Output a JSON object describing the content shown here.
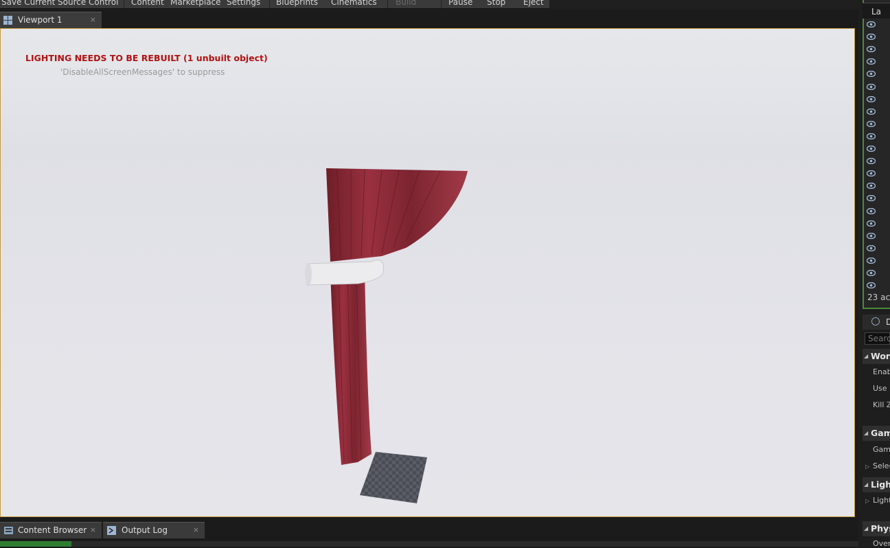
{
  "toolbar": {
    "items": [
      "Save Current",
      "Source Control",
      "Content",
      "Marketplace",
      "Settings",
      "Blueprints",
      "Cinematics",
      "Build",
      "Pause",
      "Stop",
      "Eject"
    ]
  },
  "viewport_tab": {
    "label": "Viewport 1",
    "close": "×"
  },
  "viewport": {
    "warning": "LIGHTING NEEDS TO BE REBUILT (1 unbuilt object)",
    "suppress_hint": "'DisableAllScreenMessages' to suppress"
  },
  "bottom_tabs": [
    {
      "label": "Content Browser",
      "close": "×"
    },
    {
      "label": "Output Log",
      "close": "×"
    }
  ],
  "outliner": {
    "header": "La",
    "actor_count": "23 ac"
  },
  "details": {
    "header": "De",
    "search_placeholder": "Searc",
    "sections": [
      {
        "label": "World",
        "props": [
          "Enab",
          "Use (",
          "Kill Z"
        ]
      },
      {
        "label": "Gam",
        "props": [
          "Game",
          "Selec"
        ]
      },
      {
        "label": "Light",
        "props": [
          "Light"
        ]
      },
      {
        "label": "Phys",
        "props": [
          "Over"
        ]
      }
    ]
  },
  "colors": {
    "accent_border": "#c49a3c",
    "warning_text": "#b11212",
    "outliner_border": "#4c8a3c",
    "curtain": "#8a2a35"
  }
}
